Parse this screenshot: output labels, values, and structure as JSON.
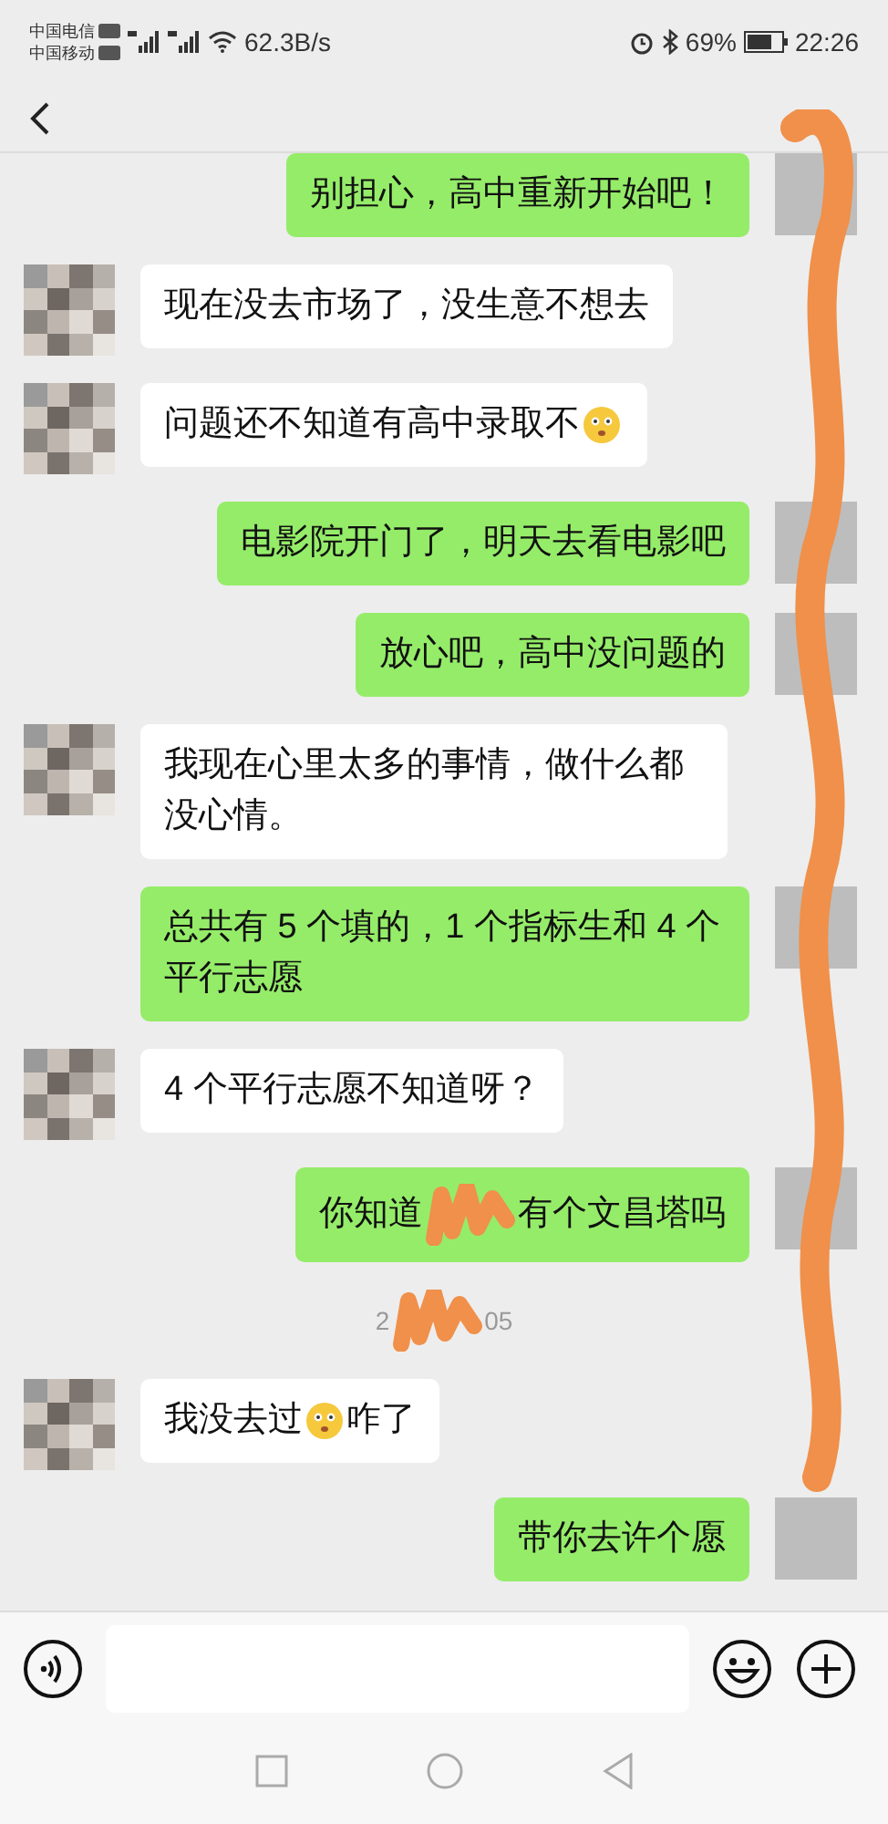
{
  "status_bar": {
    "carriers": [
      "中国电信",
      "中国移动"
    ],
    "speed": "62.3B/s",
    "battery": "69%",
    "time": "22:26"
  },
  "items": [
    {
      "kind": "message",
      "outgoing": true,
      "parts": [
        {
          "kind": "text",
          "text": "别担心，高中重新开始吧！"
        }
      ]
    },
    {
      "kind": "message",
      "outgoing": false,
      "parts": [
        {
          "kind": "text",
          "text": "现在没去市场了，没生意不想去"
        }
      ]
    },
    {
      "kind": "message",
      "outgoing": false,
      "parts": [
        {
          "kind": "text",
          "text": "问题还不知道有高中录取不"
        },
        {
          "kind": "emoji"
        }
      ]
    },
    {
      "kind": "message",
      "outgoing": true,
      "parts": [
        {
          "kind": "text",
          "text": "电影院开门了，明天去看电影吧"
        }
      ]
    },
    {
      "kind": "message",
      "outgoing": true,
      "parts": [
        {
          "kind": "text",
          "text": "放心吧，高中没问题的"
        }
      ]
    },
    {
      "kind": "message",
      "outgoing": false,
      "parts": [
        {
          "kind": "text",
          "text": "我现在心里太多的事情，做什么都没心情。"
        }
      ]
    },
    {
      "kind": "message",
      "outgoing": true,
      "parts": [
        {
          "kind": "text",
          "text": "总共有 5 个填的，1 个指标生和 4 个平行志愿"
        }
      ]
    },
    {
      "kind": "message",
      "outgoing": false,
      "parts": [
        {
          "kind": "text",
          "text": "4 个平行志愿不知道呀？"
        }
      ]
    },
    {
      "kind": "message",
      "outgoing": true,
      "parts": [
        {
          "kind": "text",
          "text": "你知道"
        },
        {
          "kind": "redacted"
        },
        {
          "kind": "text",
          "text": "有个文昌塔吗"
        }
      ]
    },
    {
      "kind": "time",
      "parts": [
        {
          "kind": "text",
          "text": "2"
        },
        {
          "kind": "redacted"
        },
        {
          "kind": "text",
          "text": "05"
        }
      ]
    },
    {
      "kind": "message",
      "outgoing": false,
      "parts": [
        {
          "kind": "text",
          "text": "我没去过"
        },
        {
          "kind": "emoji"
        },
        {
          "kind": "text",
          "text": "咋了"
        }
      ]
    },
    {
      "kind": "message",
      "outgoing": true,
      "parts": [
        {
          "kind": "text",
          "text": "带你去许个愿"
        }
      ]
    }
  ]
}
